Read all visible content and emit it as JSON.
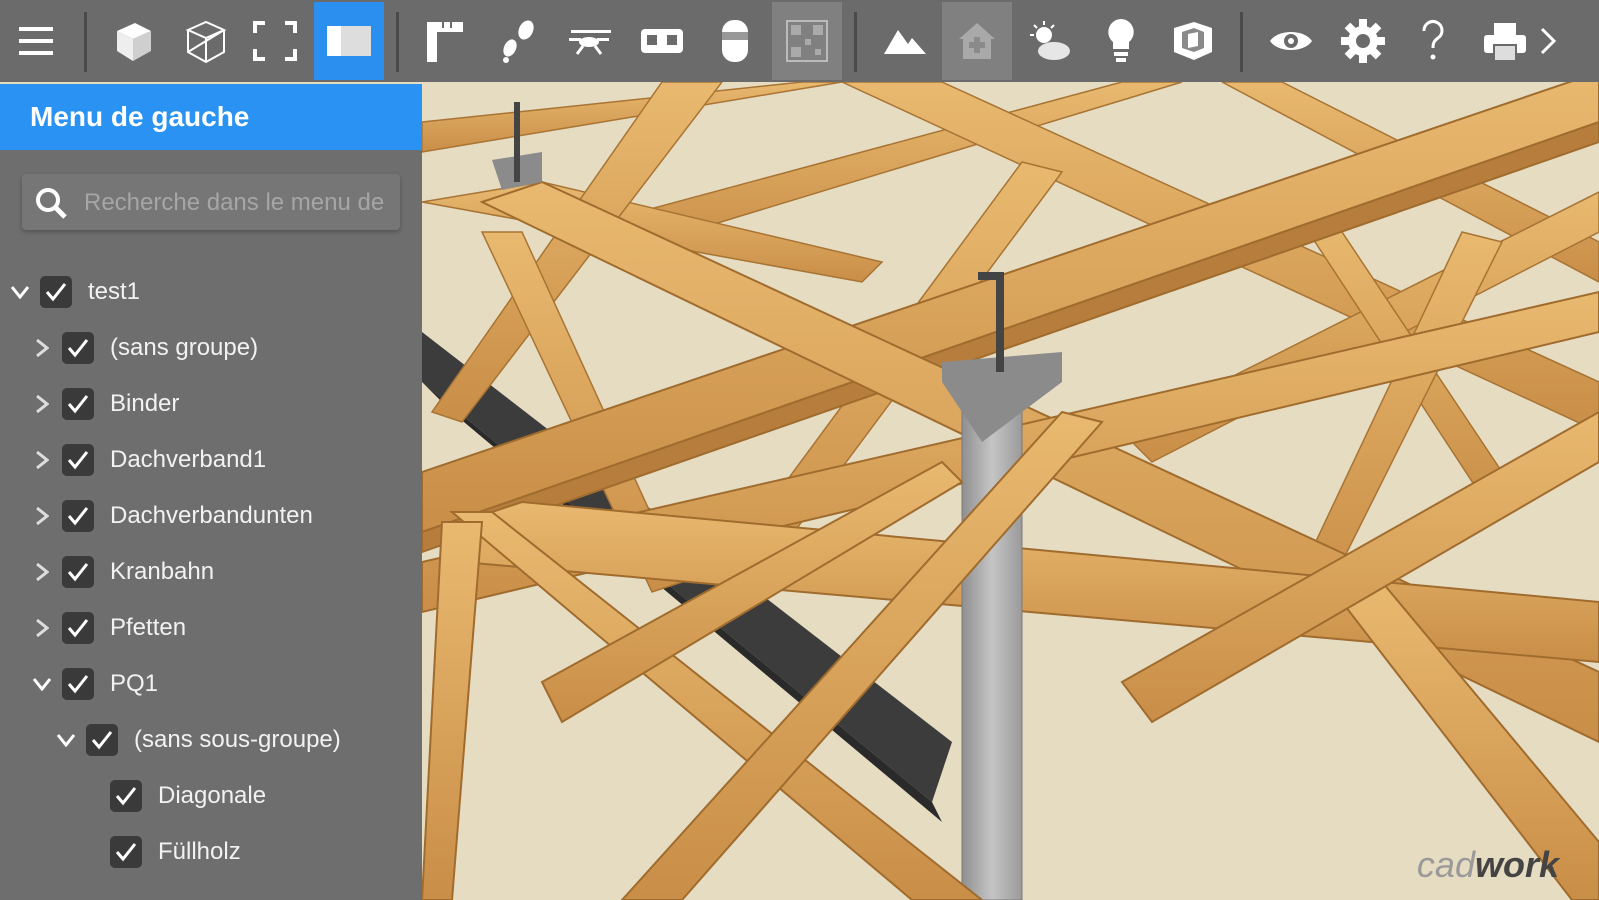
{
  "toolbar": {
    "buttons": [
      {
        "name": "menu-icon"
      },
      {
        "name": "solid-view-icon"
      },
      {
        "name": "wireframe-view-icon"
      },
      {
        "name": "fullscreen-icon"
      },
      {
        "name": "left-panel-icon",
        "state": "active"
      },
      {
        "name": "measure-icon"
      },
      {
        "name": "walk-icon"
      },
      {
        "name": "drone-icon"
      },
      {
        "name": "vr-headset-icon"
      },
      {
        "name": "object-icon"
      },
      {
        "name": "qr-code-icon",
        "state": "pressed"
      },
      {
        "name": "terrain-icon"
      },
      {
        "name": "house-icon",
        "state": "pressed"
      },
      {
        "name": "weather-icon"
      },
      {
        "name": "lightbulb-icon"
      },
      {
        "name": "section-box-icon"
      },
      {
        "name": "eye-icon"
      },
      {
        "name": "gear-icon"
      },
      {
        "name": "help-icon"
      },
      {
        "name": "print-icon"
      },
      {
        "name": "chevron-right-icon"
      }
    ]
  },
  "sidebar": {
    "title": "Menu de gauche",
    "search_placeholder": "Recherche dans le menu de",
    "tree": [
      {
        "label": "test1",
        "level": 0,
        "expanded": true,
        "checked": true
      },
      {
        "label": "(sans groupe)",
        "level": 1,
        "expanded": false,
        "checked": true
      },
      {
        "label": "Binder",
        "level": 1,
        "expanded": false,
        "checked": true
      },
      {
        "label": "Dachverband1",
        "level": 1,
        "expanded": false,
        "checked": true
      },
      {
        "label": "Dachverbandunten",
        "level": 1,
        "expanded": false,
        "checked": true
      },
      {
        "label": "Kranbahn",
        "level": 1,
        "expanded": false,
        "checked": true
      },
      {
        "label": "Pfetten",
        "level": 1,
        "expanded": false,
        "checked": true
      },
      {
        "label": "PQ1",
        "level": 1,
        "expanded": true,
        "checked": true
      },
      {
        "label": "(sans sous-groupe)",
        "level": 2,
        "expanded": true,
        "checked": true
      },
      {
        "label": "Diagonale",
        "level": 3,
        "leaf": true,
        "checked": true
      },
      {
        "label": "Füllholz",
        "level": 3,
        "leaf": true,
        "checked": true
      }
    ]
  },
  "viewport": {
    "watermark_prefix": "cad",
    "watermark_main": "work"
  },
  "colors": {
    "accent": "#2a92f2",
    "toolbar_bg": "#6b6b6b",
    "sidebar_bg": "#6e6e6e",
    "scene_bg": "#e6dcc2",
    "wood": "#d9a25b"
  }
}
